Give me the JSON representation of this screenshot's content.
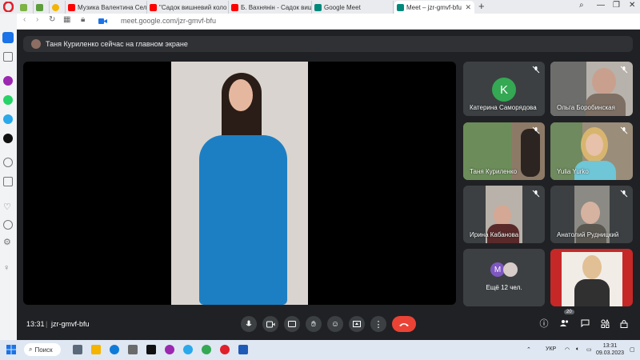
{
  "browser": {
    "tabs": [
      {
        "label": "",
        "favicon_color": "#7cb342"
      },
      {
        "label": "",
        "favicon_color": "#5c9d3a"
      },
      {
        "label": "",
        "favicon_color": "#f4b400"
      },
      {
        "label": "Музика Валентина Сельв...",
        "favicon_color": "#ff0000"
      },
      {
        "label": "\"Садок вишневий коло х...",
        "favicon_color": "#ff0000"
      },
      {
        "label": "Б. Вахнянін - Садок вишн...",
        "favicon_color": "#ff0000"
      },
      {
        "label": "Google Meet",
        "favicon_color": "#00897b"
      },
      {
        "label": "Meet – jzr-gmvf-bfu",
        "favicon_color": "#00897b"
      }
    ],
    "url": "meet.google.com/jzr-gmvf-bfu"
  },
  "meet": {
    "banner_text": "Таня Куриленко сейчас на главном экране",
    "participants": [
      {
        "name": "Катерина Саморядова",
        "initial": "K",
        "avatar_color": "#34a853"
      },
      {
        "name": "Ольга Боробинская"
      },
      {
        "name": "Таня Куриленко"
      },
      {
        "name": "Yulia Yurko"
      },
      {
        "name": "Ирина Кабанова"
      },
      {
        "name": "Анатолий Рудницкий"
      }
    ],
    "more": {
      "label": "Ещё 12 чел.",
      "initial": "M"
    },
    "time": "13:31",
    "meeting_code": "jzr-gmvf-bfu",
    "people_count": "20"
  },
  "taskbar": {
    "search_label": "Поиск",
    "lang": "УКР",
    "time": "13:31",
    "date": "09.03.2023"
  },
  "colors": {
    "meet_bg": "#202124",
    "end_call": "#ea4335",
    "accent_blue": "#1a73e8"
  }
}
